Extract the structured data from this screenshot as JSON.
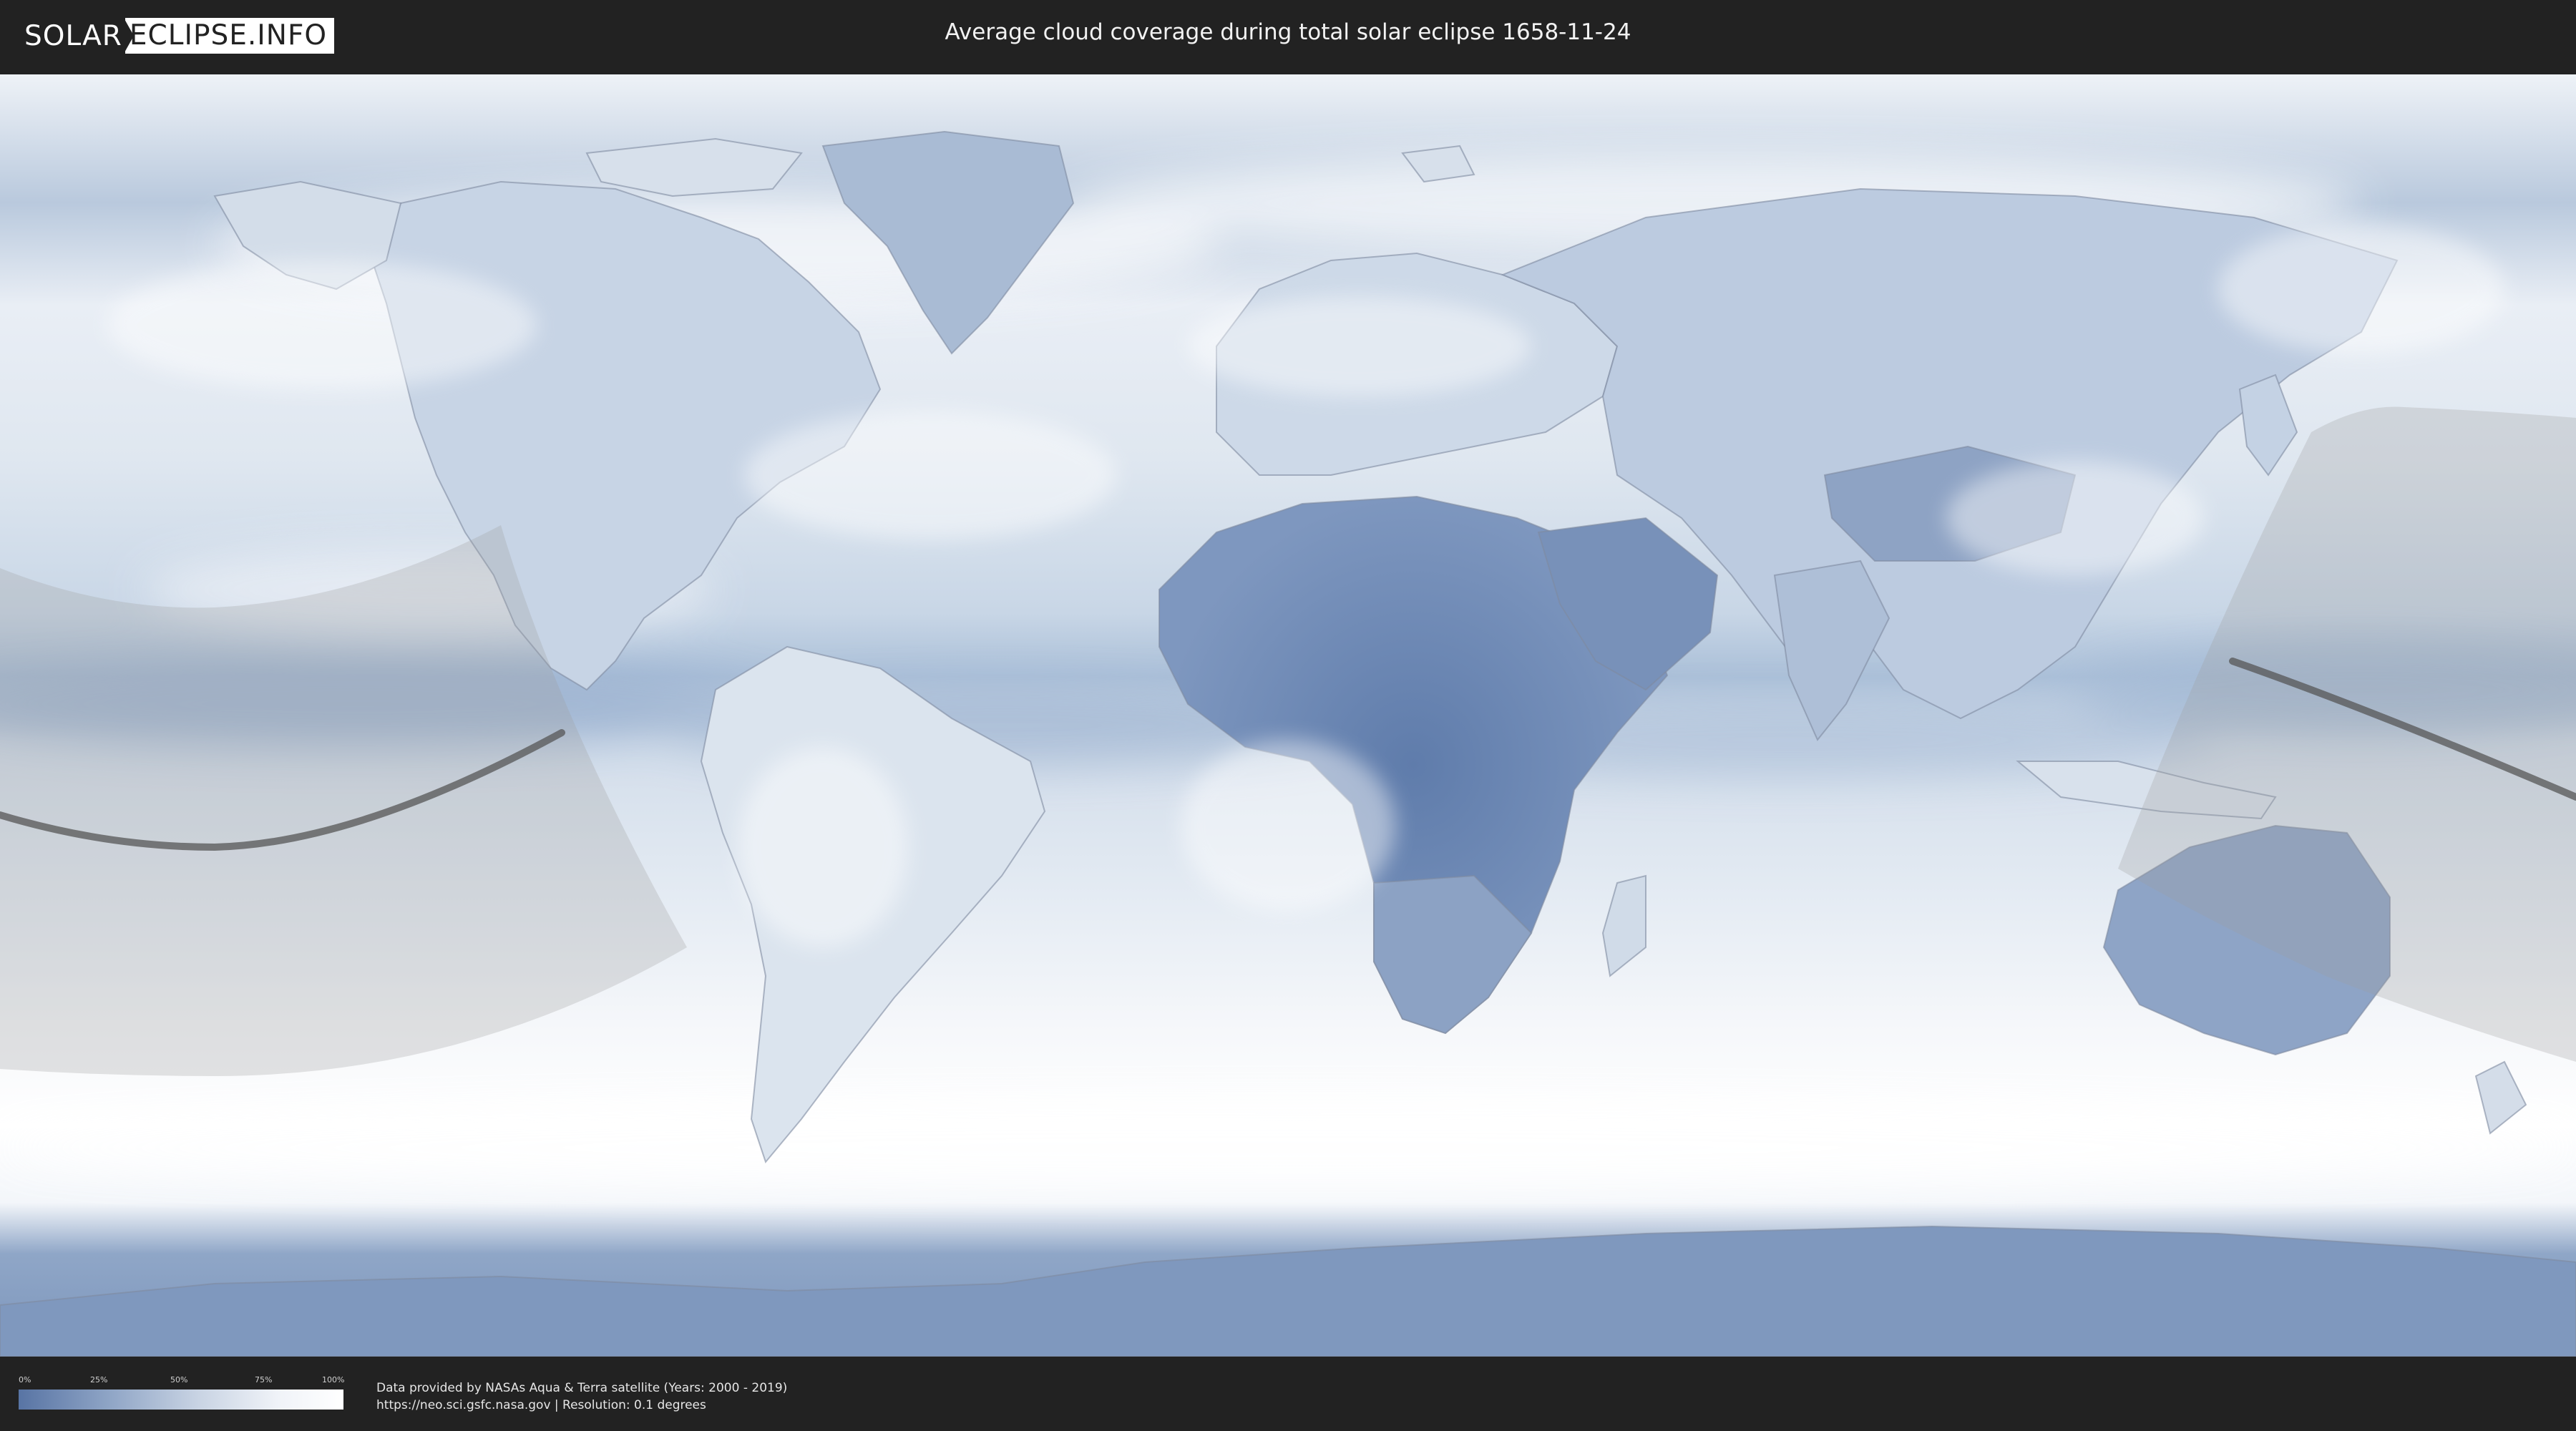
{
  "header": {
    "logo_part1": "SOLAR",
    "logo_part2": "ECLIPSE.INFO",
    "title": "Average cloud coverage during total solar eclipse 1658-11-24"
  },
  "legend": {
    "ticks": [
      "0%",
      "25%",
      "50%",
      "75%",
      "100%"
    ],
    "gradient_colors": [
      "#5874a4",
      "#8fa5c6",
      "#c8d3e3",
      "#f0f3f8",
      "#ffffff"
    ]
  },
  "footer": {
    "credit_line1": "Data provided by NASAs Aqua & Terra satellite (Years: 2000 - 2019)",
    "credit_line2": "https://neo.sci.gsfc.nasa.gov | Resolution: 0.1 degrees"
  },
  "colors": {
    "background": "#222222",
    "cloud_clear": "#5b78a8",
    "cloud_full": "#ffffff",
    "eclipse_zone": "#a8a8a8",
    "central_line": "#555555"
  }
}
